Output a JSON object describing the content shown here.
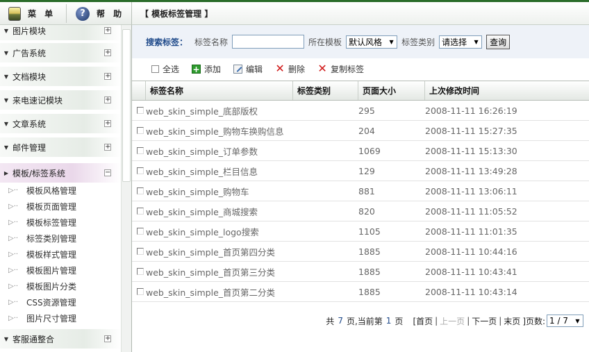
{
  "header": {
    "menu_label": "菜 单",
    "help_label": "帮 助",
    "page_title": "【 模板标签管理 】"
  },
  "sidebar": {
    "groups": [
      {
        "label": "图片模块",
        "toggle": "+"
      },
      {
        "label": "广告系统",
        "toggle": "+"
      },
      {
        "label": "文档模块",
        "toggle": "+"
      },
      {
        "label": "来电速记模块",
        "toggle": "+"
      },
      {
        "label": "文章系统",
        "toggle": "+"
      },
      {
        "label": "邮件管理",
        "toggle": "+"
      },
      {
        "label": "模板/标签系统",
        "toggle": "−"
      },
      {
        "label": "客服通整合",
        "toggle": "+"
      }
    ],
    "subitems": [
      "模板风格管理",
      "模板页面管理",
      "模板标签管理",
      "标签类别管理",
      "模板样式管理",
      "模板图片管理",
      "模板图片分类",
      "CSS资源管理",
      "图片尺寸管理"
    ]
  },
  "search": {
    "title": "搜索标签：",
    "name_label": "标签名称",
    "name_value": "",
    "template_label": "所在模板",
    "template_value": "默认风格",
    "category_label": "标签类别",
    "category_value": "请选择",
    "query_button": "查询"
  },
  "toolbar": {
    "select_all": "全选",
    "add": "添加",
    "edit": "编辑",
    "delete": "删除",
    "copy": "复制标签"
  },
  "table": {
    "headers": [
      "标签名称",
      "标签类别",
      "页面大小",
      "上次修改时间"
    ],
    "rows": [
      {
        "name": "web_skin_simple_底部版权",
        "category": "",
        "size": "295",
        "modified": "2008-11-11 16:26:19"
      },
      {
        "name": "web_skin_simple_购物车换购信息",
        "category": "",
        "size": "204",
        "modified": "2008-11-11 15:27:35"
      },
      {
        "name": "web_skin_simple_订单参数",
        "category": "",
        "size": "1069",
        "modified": "2008-11-11 15:13:30"
      },
      {
        "name": "web_skin_simple_栏目信息",
        "category": "",
        "size": "129",
        "modified": "2008-11-11 13:49:28"
      },
      {
        "name": "web_skin_simple_购物车",
        "category": "",
        "size": "881",
        "modified": "2008-11-11 13:06:11"
      },
      {
        "name": "web_skin_simple_商城搜索",
        "category": "",
        "size": "820",
        "modified": "2008-11-11 11:05:52"
      },
      {
        "name": "web_skin_simple_logo搜索",
        "category": "",
        "size": "1105",
        "modified": "2008-11-11 11:01:35"
      },
      {
        "name": "web_skin_simple_首页第四分类",
        "category": "",
        "size": "1885",
        "modified": "2008-11-11 10:44:16"
      },
      {
        "name": "web_skin_simple_首页第三分类",
        "category": "",
        "size": "1885",
        "modified": "2008-11-11 10:43:41"
      },
      {
        "name": "web_skin_simple_首页第二分类",
        "category": "",
        "size": "1885",
        "modified": "2008-11-11 10:43:14"
      }
    ]
  },
  "pager": {
    "total_prefix": "共",
    "total_pages": "7",
    "total_suffix": "页,当前第",
    "current_page": "1",
    "current_suffix": "页",
    "first": "[首页",
    "prev": "上一页",
    "next": "下一页",
    "last": "末页",
    "page_label": "]页数:",
    "page_select": "1 / 7"
  },
  "colors": {
    "accent": "#1f4a8a",
    "header_bar": "#2a6c2a",
    "search_bg": "#eef2f8"
  }
}
